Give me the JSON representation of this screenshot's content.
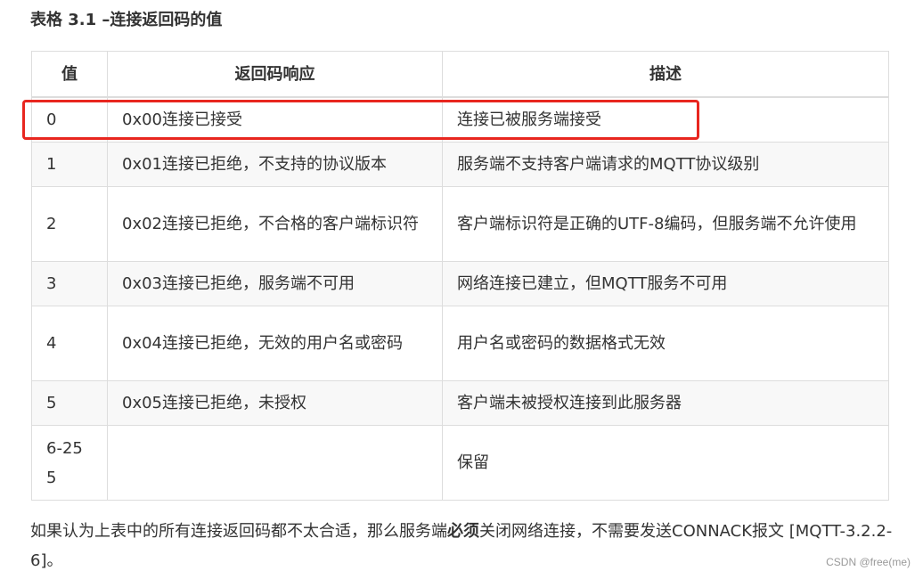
{
  "table_title": "表格 3.1 –连接返回码的值",
  "columns": [
    "值",
    "返回码响应",
    "描述"
  ],
  "rows": [
    {
      "value": "0",
      "response": "0x00连接已接受",
      "description": "连接已被服务端接受"
    },
    {
      "value": "1",
      "response": "0x01连接已拒绝，不支持的协议版本",
      "description": "服务端不支持客户端请求的MQTT协议级别"
    },
    {
      "value": "2",
      "response": "0x02连接已拒绝，不合格的客户端标识符",
      "description": "客户端标识符是正确的UTF-8编码，但服务端不允许使用"
    },
    {
      "value": "3",
      "response": "0x03连接已拒绝，服务端不可用",
      "description": "网络连接已建立，但MQTT服务不可用"
    },
    {
      "value": "4",
      "response": "0x04连接已拒绝，无效的用户名或密码",
      "description": "用户名或密码的数据格式无效"
    },
    {
      "value": "5",
      "response": "0x05连接已拒绝，未授权",
      "description": "客户端未被授权连接到此服务器"
    },
    {
      "value": "6-255",
      "response": "",
      "description": "保留"
    }
  ],
  "footnote": {
    "before": "如果认为上表中的所有连接返回码都不太合适，那么服务端",
    "bold": "必须",
    "after": "关闭网络连接，不需要发送CONNACK报文 [MQTT-3.2.2-6]。"
  },
  "watermark": "CSDN @free(me)",
  "colors": {
    "highlight": "#e8261f",
    "border": "#dddddd",
    "stripe": "#f8f8f8"
  }
}
